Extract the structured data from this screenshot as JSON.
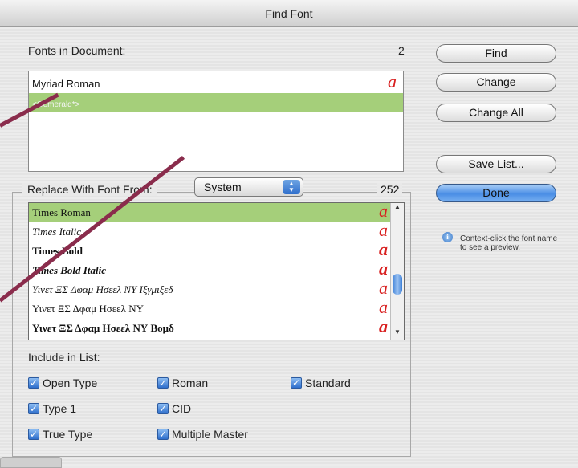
{
  "window": {
    "title": "Find Font"
  },
  "fonts_in_document": {
    "label": "Fonts in Document:",
    "count": "2",
    "items": [
      {
        "name": "Myriad Roman",
        "glyph": "a",
        "selected": false
      },
      {
        "name": "<Gemerald*>",
        "glyph": "",
        "selected": true
      }
    ]
  },
  "replace": {
    "label": "Replace With Font From:",
    "source": "System",
    "count": "252",
    "items": [
      {
        "name": "Times Roman",
        "glyph": "a",
        "selected": true
      },
      {
        "name": "Times Italic",
        "glyph": "a",
        "selected": false
      },
      {
        "name": "Times Bold",
        "glyph": "a",
        "selected": false
      },
      {
        "name": "Times Bold Italic",
        "glyph": "a",
        "selected": false
      },
      {
        "name": "Υινετ ΞΣ Δφαμ Ησεελ ΝΥ Ιξγμιξεδ",
        "glyph": "a",
        "selected": false
      },
      {
        "name": "Υινετ ΞΣ Δφαμ Ησεελ ΝΥ",
        "glyph": "a",
        "selected": false
      },
      {
        "name": "Υινετ ΞΣ Δφαμ Ησεελ ΝΥ Βομδ",
        "glyph": "a",
        "selected": false
      }
    ]
  },
  "include": {
    "label": "Include in List:",
    "options": [
      {
        "label": "Open Type",
        "checked": true
      },
      {
        "label": "Type 1",
        "checked": true
      },
      {
        "label": "True Type",
        "checked": true
      },
      {
        "label": "Roman",
        "checked": true
      },
      {
        "label": "CID",
        "checked": true
      },
      {
        "label": "Multiple Master",
        "checked": true
      },
      {
        "label": "Standard",
        "checked": true
      }
    ]
  },
  "buttons": {
    "find": "Find",
    "change": "Change",
    "change_all": "Change All",
    "save_list": "Save List...",
    "done": "Done"
  },
  "hint": "Context-click the font name to see a preview.",
  "icons": {
    "info": "info-icon",
    "popup": "updown-arrows-icon",
    "check": "checkmark-icon"
  },
  "colors": {
    "selection": "#a5cf7a",
    "glyph": "#d81e1e",
    "accent": "#3c7fd7",
    "pointer": "#8a2c4c"
  }
}
